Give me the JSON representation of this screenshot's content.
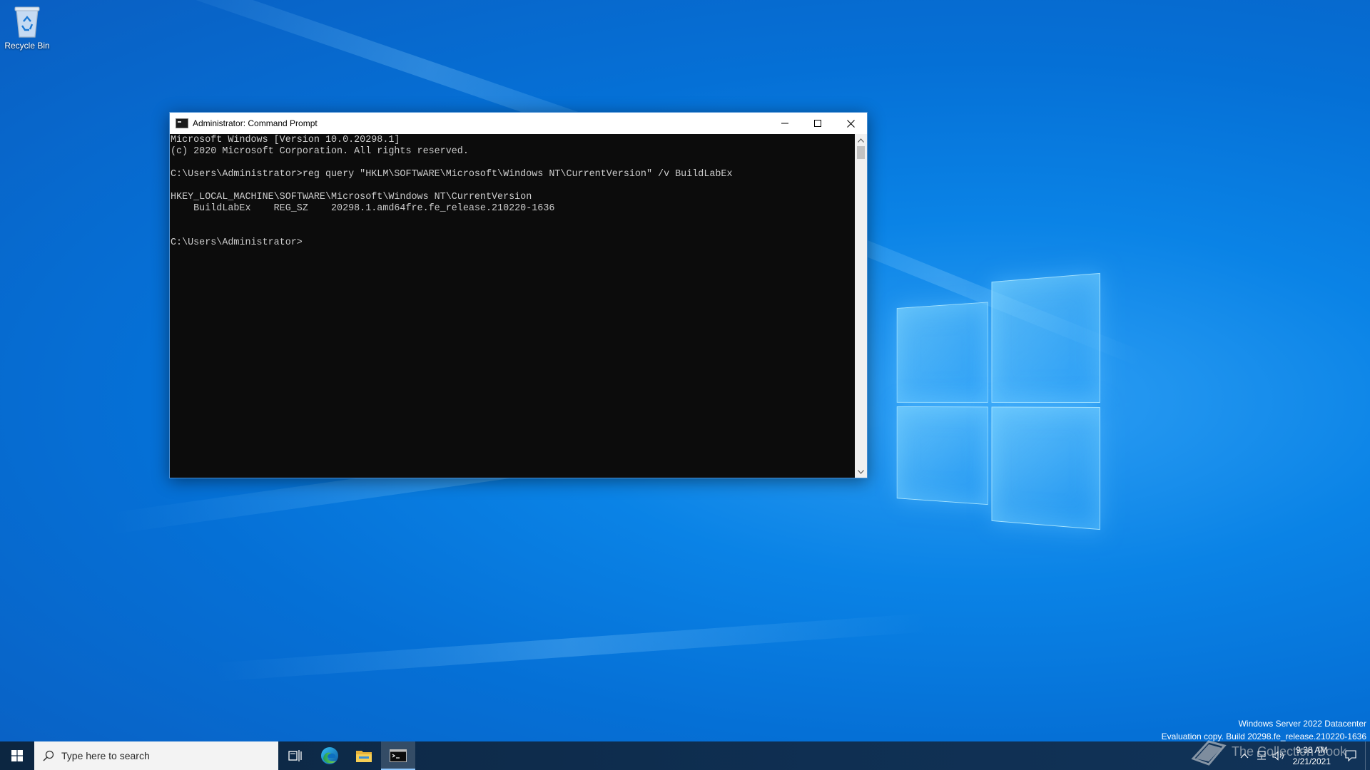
{
  "desktop": {
    "icons": [
      {
        "label": "Recycle Bin",
        "icon": "recycle-bin-icon"
      }
    ],
    "watermark": {
      "line1": "Windows Server 2022 Datacenter",
      "line2": "Evaluation copy. Build 20298.fe_release.210220-1636"
    },
    "brand_overlay": "The Collection Book"
  },
  "cmd": {
    "title": "Administrator: Command Prompt",
    "lines": [
      "Microsoft Windows [Version 10.0.20298.1]",
      "(c) 2020 Microsoft Corporation. All rights reserved.",
      "",
      "C:\\Users\\Administrator>reg query \"HKLM\\SOFTWARE\\Microsoft\\Windows NT\\CurrentVersion\" /v BuildLabEx",
      "",
      "HKEY_LOCAL_MACHINE\\SOFTWARE\\Microsoft\\Windows NT\\CurrentVersion",
      "    BuildLabEx    REG_SZ    20298.1.amd64fre.fe_release.210220-1636",
      "",
      "",
      "C:\\Users\\Administrator>"
    ]
  },
  "taskbar": {
    "search_placeholder": "Type here to search",
    "apps": [
      {
        "name": "task-view",
        "icon": "task-view-icon",
        "active": false
      },
      {
        "name": "edge",
        "icon": "edge-icon",
        "active": false
      },
      {
        "name": "file-explorer",
        "icon": "folder-icon",
        "active": false
      },
      {
        "name": "command-prompt",
        "icon": "terminal-icon",
        "active": true
      }
    ],
    "clock": {
      "time": "9:38 AM",
      "date": "2/21/2021"
    }
  },
  "colors": {
    "console_bg": "#0c0c0c",
    "console_fg": "#cccccc",
    "taskbar_bg": "#0f2f52",
    "accent": "#8fc8ff"
  }
}
